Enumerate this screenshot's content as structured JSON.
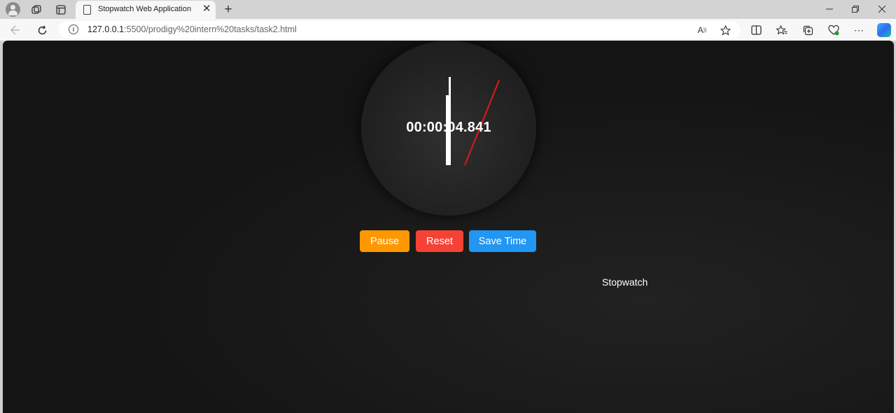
{
  "browser": {
    "tab_title": "Stopwatch Web Application",
    "url_host": "127.0.0.1",
    "url_rest": ":5500/prodigy%20intern%20tasks/task2.html"
  },
  "page": {
    "time_display": "00:00:04.841",
    "buttons": {
      "pause": "Pause",
      "reset": "Reset",
      "save": "Save Time"
    },
    "title_label": "Stopwatch"
  },
  "colors": {
    "pause": "#ff9800",
    "reset": "#f44336",
    "save": "#2196f3",
    "second_hand": "#e01818"
  }
}
